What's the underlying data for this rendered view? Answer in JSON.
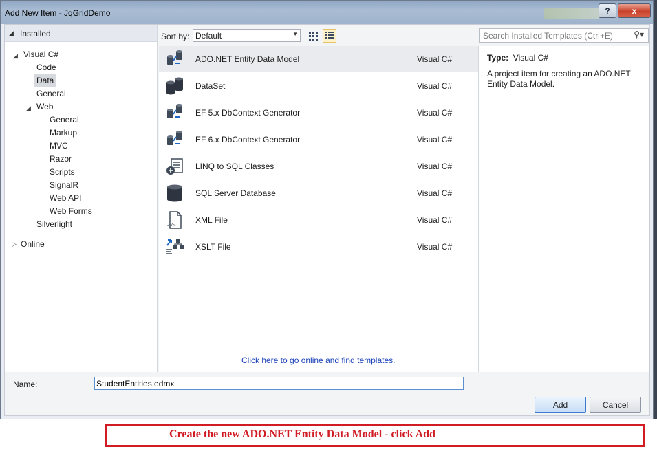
{
  "window": {
    "title": "Add New Item - JqGridDemo",
    "help_label": "?",
    "close_label": "x"
  },
  "tree": {
    "installed": "Installed",
    "visual_csharp": "Visual C#",
    "code": "Code",
    "data": "Data",
    "general": "General",
    "web": "Web",
    "web_children": [
      "General",
      "Markup",
      "MVC",
      "Razor",
      "Scripts",
      "SignalR",
      "Web API",
      "Web Forms"
    ],
    "silverlight": "Silverlight",
    "online": "Online",
    "selected": "Data"
  },
  "toolbar": {
    "sort_label": "Sort by:",
    "sort_value": "Default",
    "search_placeholder": "Search Installed Templates (Ctrl+E)"
  },
  "templates": [
    {
      "name": "ADO.NET Entity Data Model",
      "category": "Visual C#",
      "icon": "entity-model-icon",
      "selected": true
    },
    {
      "name": "DataSet",
      "category": "Visual C#",
      "icon": "dataset-icon"
    },
    {
      "name": "EF 5.x DbContext Generator",
      "category": "Visual C#",
      "icon": "ef-generator-icon"
    },
    {
      "name": "EF 6.x DbContext Generator",
      "category": "Visual C#",
      "icon": "ef-generator-icon"
    },
    {
      "name": "LINQ to SQL Classes",
      "category": "Visual C#",
      "icon": "linq-icon"
    },
    {
      "name": "SQL Server Database",
      "category": "Visual C#",
      "icon": "database-icon"
    },
    {
      "name": "XML File",
      "category": "Visual C#",
      "icon": "xml-file-icon"
    },
    {
      "name": "XSLT File",
      "category": "Visual C#",
      "icon": "xslt-file-icon"
    }
  ],
  "online_link": "Click here to go online and find templates.",
  "details": {
    "type_label": "Type:",
    "type_value": "Visual C#",
    "description": "A project item for creating an ADO.NET Entity Data Model."
  },
  "name_field": {
    "label": "Name:",
    "value": "StudentEntities.edmx"
  },
  "buttons": {
    "add": "Add",
    "cancel": "Cancel"
  },
  "caption": "Create the new ADO.NET Entity Data Model  - click Add",
  "colors": {
    "caption_red": "#d11c24",
    "link_blue": "#1a41b8",
    "selection": "#e9ebee"
  }
}
